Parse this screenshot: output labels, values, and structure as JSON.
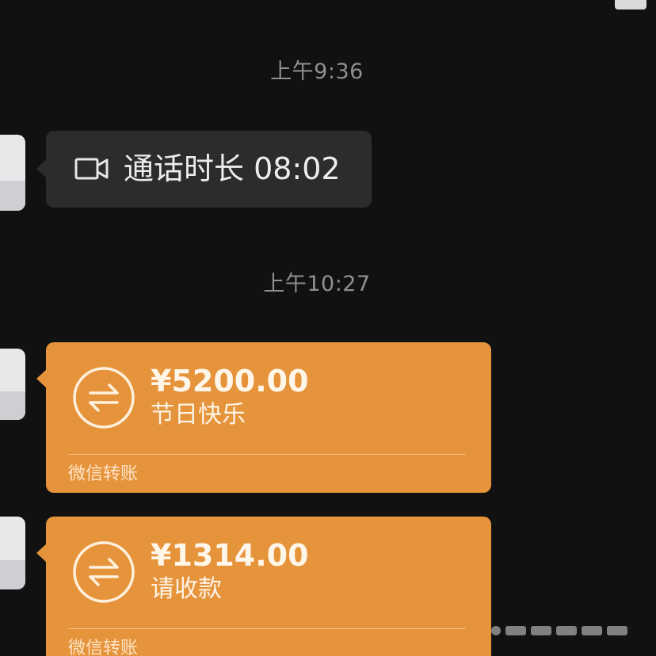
{
  "chat": {
    "timestamps": [
      "上午9:36",
      "上午10:27"
    ],
    "call": {
      "icon": "video-call-icon",
      "text": "通话时长 08:02"
    },
    "transfers": [
      {
        "amount": "¥5200.00",
        "note": "节日快乐",
        "footer": "微信转账",
        "icon": "transfer-arrows-icon"
      },
      {
        "amount": "¥1314.00",
        "note": "请收款",
        "footer": "微信转账",
        "icon": "transfer-arrows-icon"
      }
    ]
  },
  "colors": {
    "background": "#111111",
    "call_bubble": "#2c2c2c",
    "transfer_bubble": "#e6943c",
    "timestamp_text": "#8f8f8f"
  }
}
